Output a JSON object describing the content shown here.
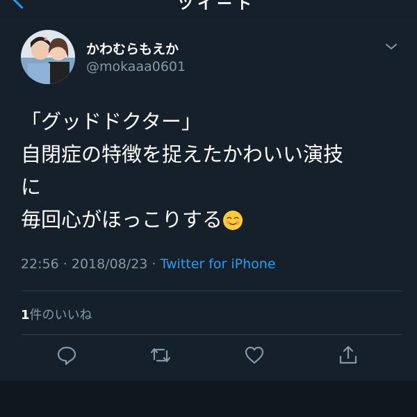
{
  "header": {
    "title_fragment": "ツイート"
  },
  "tweet": {
    "author_name": "かわむらもえか",
    "author_handle": "@mokaaa0601",
    "text": "「グッドドクター」\n自閉症の特徴を捉えたかわいい演技\nに\n毎回心がほっこりする",
    "emoji": "relieved-smiling-face",
    "timestamp": "22:56 · 2018/08/23 · ",
    "source": "Twitter for iPhone"
  },
  "stats": {
    "likes_count": "1",
    "likes_label": "件のいいね"
  },
  "actions": [
    "reply-icon",
    "retweet-icon",
    "like-icon",
    "share-icon"
  ],
  "colors": {
    "background": "#15202b",
    "accent": "#1da1f2",
    "muted": "#8899a6",
    "divider": "#2b3a48"
  }
}
